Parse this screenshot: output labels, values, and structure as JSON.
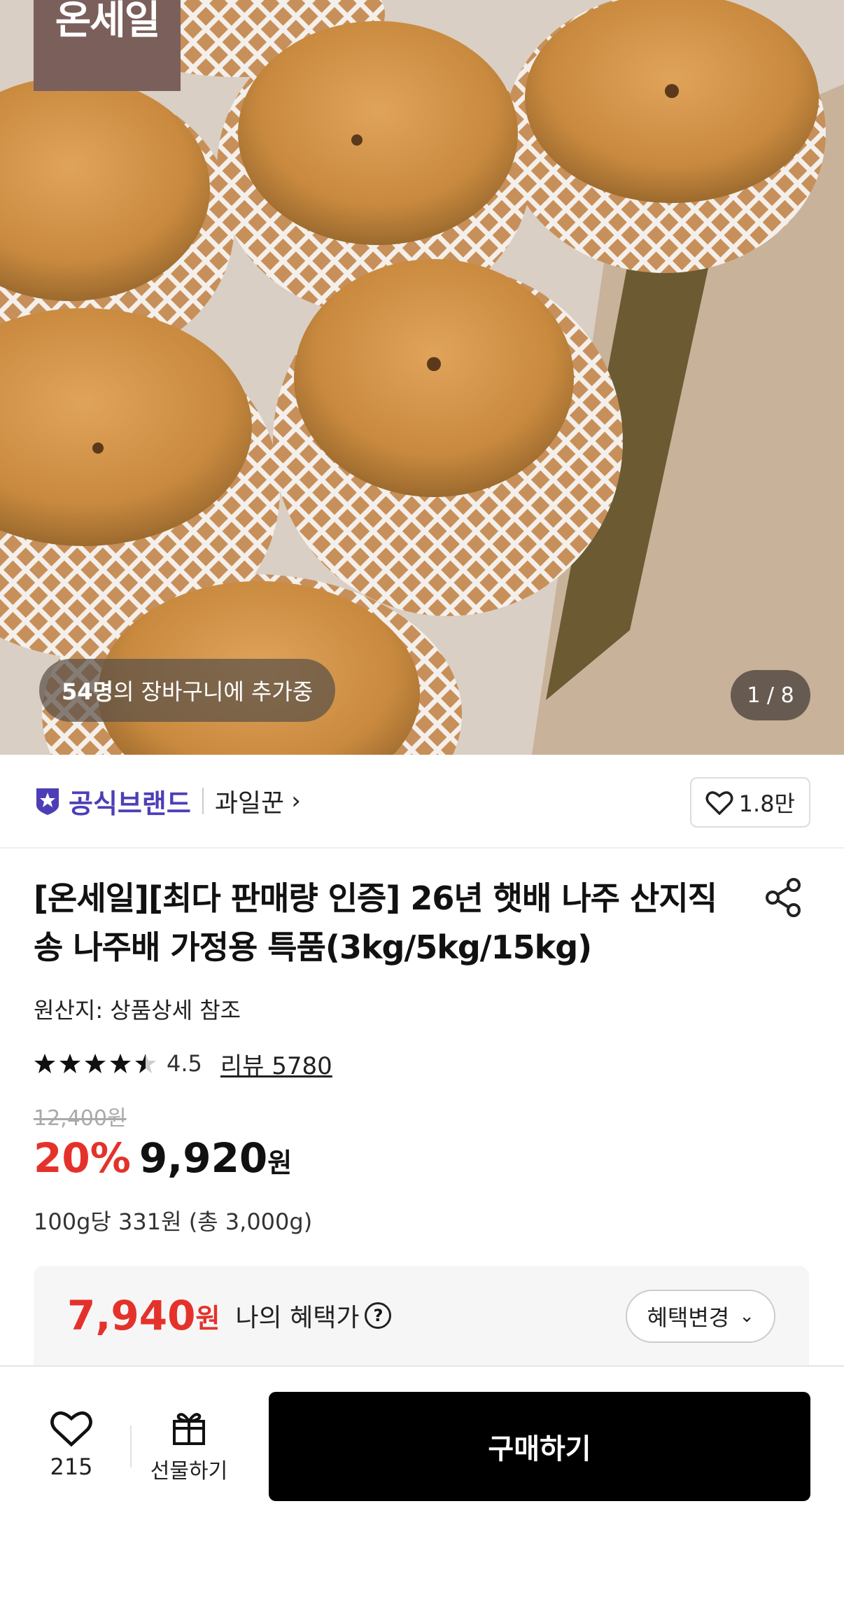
{
  "hero": {
    "brand_tag": "온세일",
    "cart_count": "54명",
    "cart_text": "의 장바구니에 추가중",
    "image_index": "1 / 8"
  },
  "brand": {
    "official_label": "공식브랜드",
    "store_name": "과일꾼",
    "like_count": "1.8만",
    "brand_color": "#4c3fb6"
  },
  "product": {
    "title": "[온세일][최다 판매량 인증] 26년 햇배 나주 산지직송 나주배 가정용 특품(3kg/5kg/15kg)",
    "origin": "원산지: 상품상세 참조",
    "rating": "4.5",
    "rating_value": 4.5,
    "reviews": "리뷰 5780",
    "original_price": "12,400원",
    "discount": "20%",
    "price": "9,920",
    "currency": "원",
    "unit_price": "100g당 331원 (총 3,000g)",
    "accent_color": "#e4322b"
  },
  "benefit": {
    "price": "7,940",
    "currency": "원",
    "label": "나의 혜택가",
    "help_icon": "question-circle-icon",
    "change_button": "혜택변경"
  },
  "bottom_bar": {
    "wish_count": "215",
    "gift_label": "선물하기",
    "buy_label": "구매하기"
  }
}
